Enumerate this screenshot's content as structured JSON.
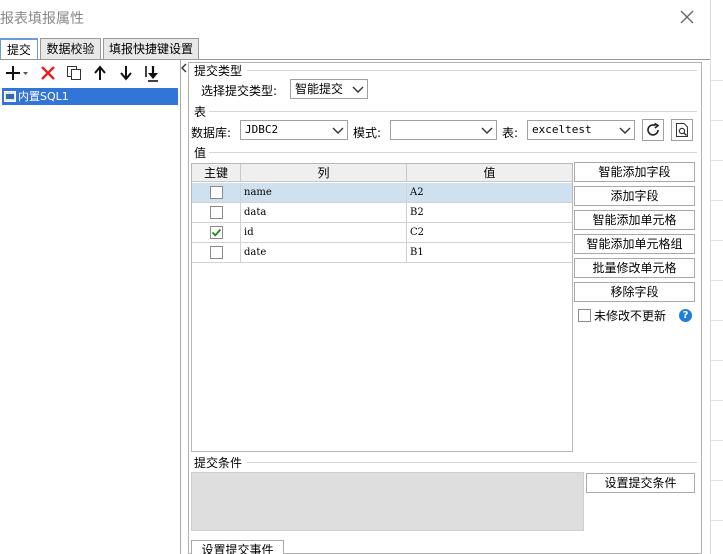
{
  "window": {
    "title": "报表填报属性"
  },
  "tabs": [
    {
      "label": "提交",
      "active": true
    },
    {
      "label": "数据校验",
      "active": false
    },
    {
      "label": "填报快捷键设置",
      "active": false
    }
  ],
  "toolbar": {
    "icons": [
      "add-icon",
      "delete-icon",
      "copy-icon",
      "arrow-up-icon",
      "arrow-down-icon",
      "move-bottom-icon"
    ]
  },
  "tree": {
    "items": [
      {
        "label": "内置SQL1",
        "selected": true
      }
    ]
  },
  "submit_type": {
    "section": "提交类型",
    "label": "选择提交类型:",
    "value": "智能提交"
  },
  "table_section": {
    "section": "表",
    "db_label": "数据库:",
    "db_value": "JDBC2",
    "schema_label": "模式:",
    "schema_value": "",
    "table_label": "表:",
    "table_value": "exceltest"
  },
  "values_section": {
    "section": "值",
    "columns": [
      "主键",
      "列",
      "值"
    ],
    "rows": [
      {
        "key": false,
        "column": "name",
        "value": "A2",
        "selected": true
      },
      {
        "key": false,
        "column": "data",
        "value": "B2",
        "selected": false
      },
      {
        "key": true,
        "column": "id",
        "value": "C2",
        "selected": false
      },
      {
        "key": false,
        "column": "date",
        "value": "B1",
        "selected": false
      }
    ]
  },
  "side_buttons": [
    "智能添加字段",
    "添加字段",
    "智能添加单元格",
    "智能添加单元格组",
    "批量修改单元格",
    "移除字段"
  ],
  "no_update_unchanged": {
    "label": "未修改不更新",
    "checked": false
  },
  "submit_condition": {
    "section": "提交条件",
    "button": "设置提交条件"
  },
  "submit_event": {
    "button": "设置提交事件"
  },
  "colors": {
    "selection": "#3375d6",
    "row_selected": "#cfe1ef",
    "tab_accent": "#6b9cd6",
    "help_icon": "#1f7fd8",
    "delete_icon": "#e02020"
  }
}
